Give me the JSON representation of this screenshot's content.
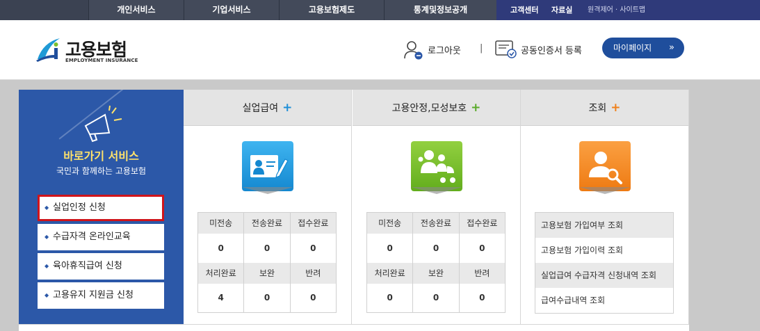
{
  "topnav": {
    "items": [
      "개인서비스",
      "기업서비스",
      "고용보험제도",
      "통계및정보공개"
    ],
    "util_bold": [
      "고객센터",
      "자료실"
    ],
    "util_light": "원격제어 · 사이트맵"
  },
  "header": {
    "logo_text": "고용보험",
    "logo_sub": "EMPLOYMENT INSURANCE",
    "logout": "로그아웃",
    "separator": "|",
    "cert": "공동인증서 등록",
    "mypage": "마이페이지",
    "mypage_arrow": "»"
  },
  "quick": {
    "title": "바로가기 서비스",
    "subtitle": "국민과 함께하는 고용보험",
    "buttons": [
      "실업인정 신청",
      "수급자격 온라인교육",
      "육아휴직급여 신청",
      "고용유지 지원금 신청"
    ]
  },
  "columns": {
    "unemployment": {
      "title": "실업급여",
      "plus": "+",
      "plus_color": "#1e8fd8",
      "header_row1": [
        "미전송",
        "전송완료",
        "접수완료"
      ],
      "values_row1": [
        "0",
        "0",
        "0"
      ],
      "header_row2": [
        "처리완료",
        "보완",
        "반려"
      ],
      "values_row2": [
        "4",
        "0",
        "0"
      ]
    },
    "stability": {
      "title": "고용안정,모성보호",
      "plus": "+",
      "plus_color": "#5aaa2a",
      "header_row1": [
        "미전송",
        "전송완료",
        "접수완료"
      ],
      "values_row1": [
        "0",
        "0",
        "0"
      ],
      "header_row2": [
        "처리완료",
        "보완",
        "반려"
      ],
      "values_row2": [
        "0",
        "0",
        "0"
      ]
    },
    "inquiry": {
      "title": "조회",
      "plus": "+",
      "plus_color": "#f0801a",
      "items": [
        "고용보험 가입여부 조회",
        "고용보험 가입이력 조회",
        "실업급여 수급자격 신청내역 조회",
        "급여수급내역 조회"
      ]
    }
  },
  "colors": {
    "nav_bg": "#434a5a",
    "util_bg": "#2f3a7a",
    "quick_bg": "#2c58a8",
    "accent_red": "#d0141b",
    "mypage_bg": "#1f4e9c",
    "icon_blue": "#1e9be0",
    "icon_green": "#7cc02e",
    "icon_orange": "#f28a1e"
  }
}
